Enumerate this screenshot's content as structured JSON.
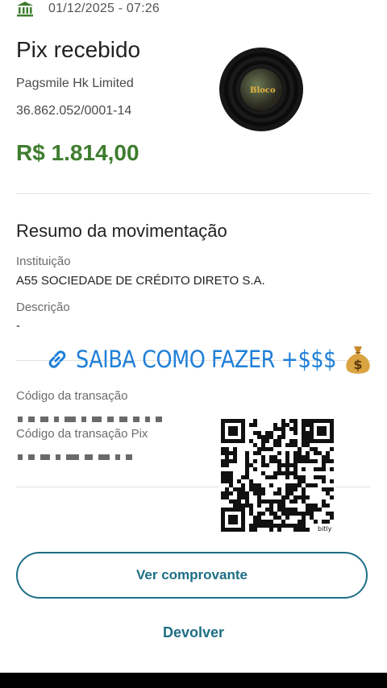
{
  "header": {
    "datetime": "01/12/2025 - 07:26",
    "icon": "bank-icon"
  },
  "transaction": {
    "title": "Pix recebido",
    "payer_name": "Pagsmile Hk Limited",
    "payer_document": "36.862.052/0001-14",
    "amount": "R$ 1.814,00"
  },
  "summary": {
    "title": "Resumo da movimentação",
    "institution_label": "Instituição",
    "institution_value": "A55 SOCIEDADE DE CRÉDITO DIRETO S.A.",
    "description_label": "Descrição",
    "description_value": "-",
    "transaction_code_label": "Código da transação",
    "pix_code_label": "Código da transação Pix"
  },
  "overlay": {
    "promo_text": "SAIBA COMO FAZER +$$$",
    "promo_icons": [
      "link-icon",
      "money-bag-icon"
    ],
    "vinyl_label": "Bloco",
    "qr_caption": "bitly"
  },
  "actions": {
    "view_receipt": "Ver comprovante",
    "return_label": "Devolver"
  },
  "colors": {
    "amount": "#3e7d2e",
    "primary": "#1e6f86",
    "promo": "#1f7fd8"
  }
}
